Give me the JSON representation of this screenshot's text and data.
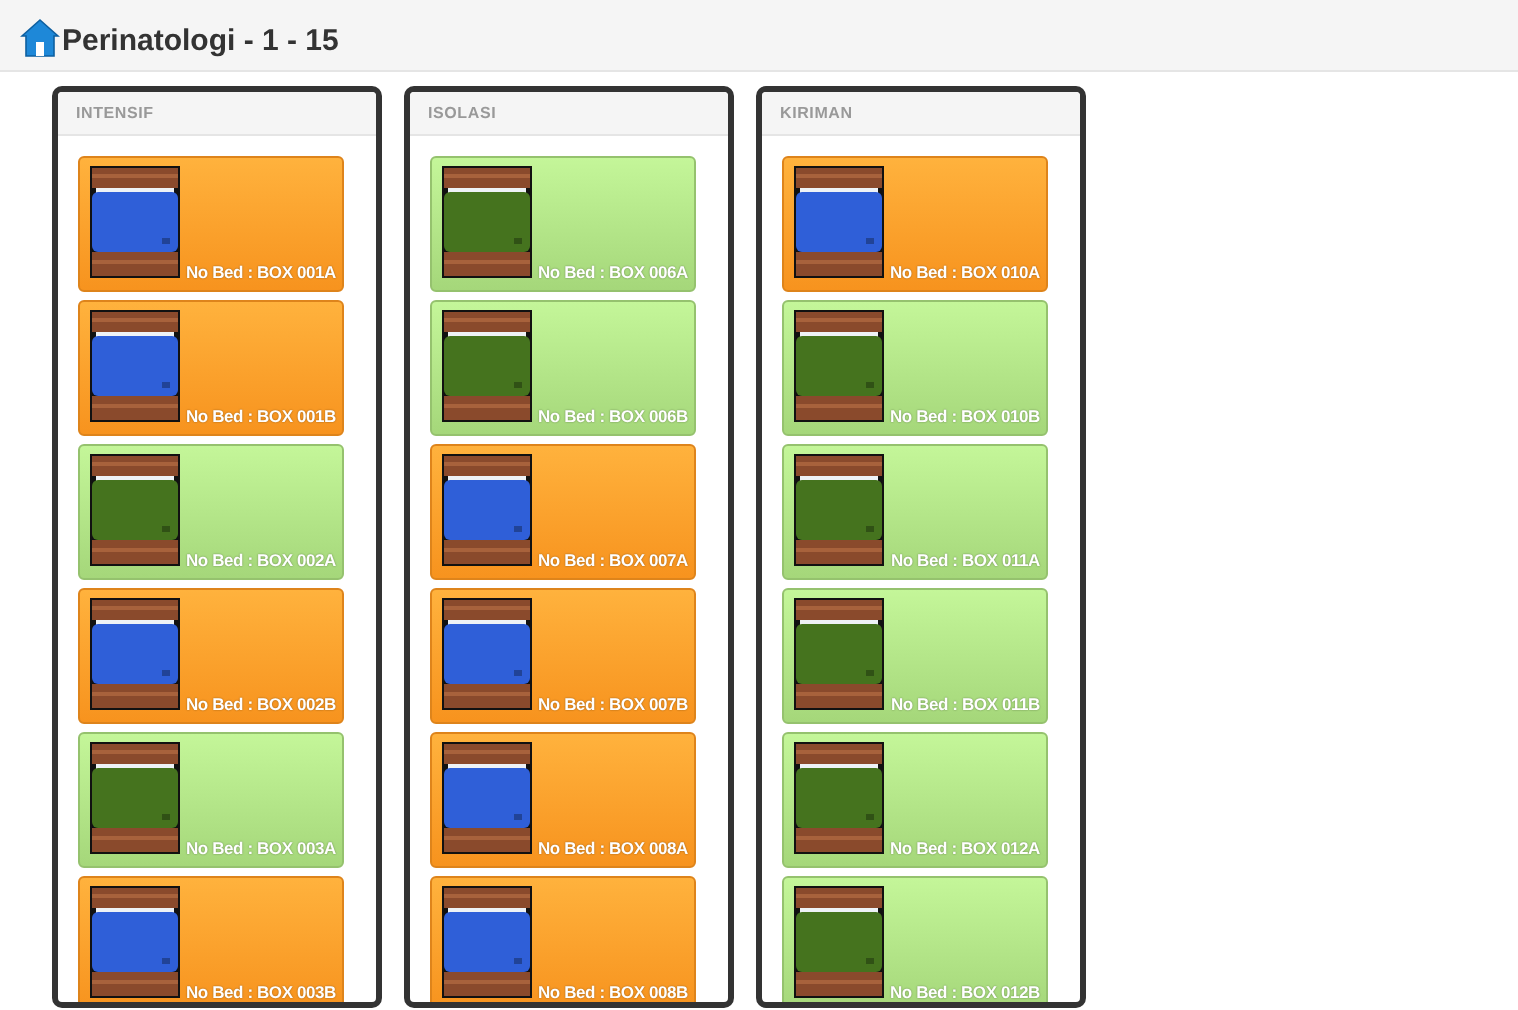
{
  "header": {
    "title": "Perinatologi - 1 - 15"
  },
  "panels": [
    {
      "title": "INTENSIF",
      "beds": [
        {
          "label": "No Bed : BOX 001A",
          "color": "#f7931e"
        },
        {
          "label": "No Bed : BOX 001B",
          "color": "#f7931e"
        },
        {
          "label": "No Bed : BOX 002A",
          "color": "#a5d77a"
        },
        {
          "label": "No Bed : BOX 002B",
          "color": "#f7931e"
        },
        {
          "label": "No Bed : BOX 003A",
          "color": "#a5d77a"
        },
        {
          "label": "No Bed : BOX 003B",
          "color": "#f7931e"
        }
      ]
    },
    {
      "title": "ISOLASI",
      "beds": [
        {
          "label": "No Bed : BOX 006A",
          "color": "#a5d77a"
        },
        {
          "label": "No Bed : BOX 006B",
          "color": "#a5d77a"
        },
        {
          "label": "No Bed : BOX 007A",
          "color": "#f7931e"
        },
        {
          "label": "No Bed : BOX 007B",
          "color": "#f7931e"
        },
        {
          "label": "No Bed : BOX 008A",
          "color": "#f7931e"
        },
        {
          "label": "No Bed : BOX 008B",
          "color": "#f7931e"
        }
      ]
    },
    {
      "title": "KIRIMAN",
      "beds": [
        {
          "label": "No Bed : BOX 010A",
          "color": "#f7931e"
        },
        {
          "label": "No Bed : BOX 010B",
          "color": "#a5d77a"
        },
        {
          "label": "No Bed : BOX 011A",
          "color": "#a5d77a"
        },
        {
          "label": "No Bed : BOX 011B",
          "color": "#a5d77a"
        },
        {
          "label": "No Bed : BOX 012A",
          "color": "#a5d77a"
        },
        {
          "label": "No Bed : BOX 012B",
          "color": "#a5d77a"
        }
      ]
    }
  ]
}
